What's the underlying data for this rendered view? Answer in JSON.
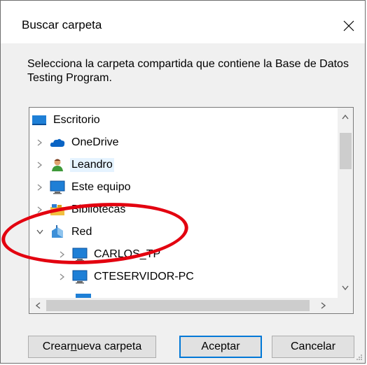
{
  "dialog": {
    "title": "Buscar carpeta",
    "description": "Selecciona la carpeta compartida que contiene la Base de Datos Testing Program."
  },
  "tree": {
    "items": [
      {
        "label": "Escritorio",
        "icon": "desktop-icon",
        "expander": "",
        "selected": false
      },
      {
        "label": "OneDrive",
        "icon": "cloud-icon",
        "expander": "collapsed",
        "selected": false
      },
      {
        "label": "Leandro",
        "icon": "user-icon",
        "expander": "collapsed",
        "selected": true
      },
      {
        "label": "Este equipo",
        "icon": "computer-icon",
        "expander": "collapsed",
        "selected": false
      },
      {
        "label": "Bibliotecas",
        "icon": "libraries-icon",
        "expander": "collapsed",
        "selected": false
      },
      {
        "label": "Red",
        "icon": "network-icon",
        "expander": "expanded",
        "selected": false
      },
      {
        "label": "CARLOS_TP",
        "icon": "computer-icon",
        "expander": "collapsed",
        "selected": false
      },
      {
        "label": "CTESERVIDOR-PC",
        "icon": "computer-icon",
        "expander": "collapsed",
        "selected": false
      }
    ]
  },
  "buttons": {
    "new_folder": "Crear nueva carpeta",
    "new_folder_mnemonic": "n",
    "accept": "Aceptar",
    "cancel": "Cancelar"
  },
  "annotation": {
    "color": "#e3000f",
    "shape": "ellipse around Red"
  },
  "colors": {
    "selection": "#e5f3ff",
    "accent": "#0078d7"
  }
}
